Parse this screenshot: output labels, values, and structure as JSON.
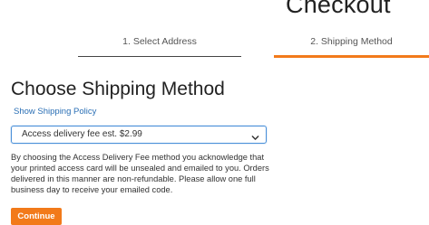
{
  "header": {
    "title": "Checkout"
  },
  "steps": [
    {
      "label": "1. Select Address",
      "active": false
    },
    {
      "label": "2. Shipping Method",
      "active": true
    }
  ],
  "main": {
    "heading": "Choose Shipping Method",
    "policy_link": "Show Shipping Policy",
    "shipping_select": {
      "selected": "Access delivery fee est. $2.99",
      "icon": "chevron-down-icon"
    },
    "disclaimer": "By choosing the Access Delivery Fee method you acknowledge that your printed access card will be unsealed and emailed to you. Orders delivered in this manner are non-refundable. Please allow one full business day to receive your emailed code.",
    "continue_label": "Continue"
  },
  "colors": {
    "accent": "#f27a1a",
    "link": "#2a6fb5",
    "focus_border": "#4a90d9"
  }
}
